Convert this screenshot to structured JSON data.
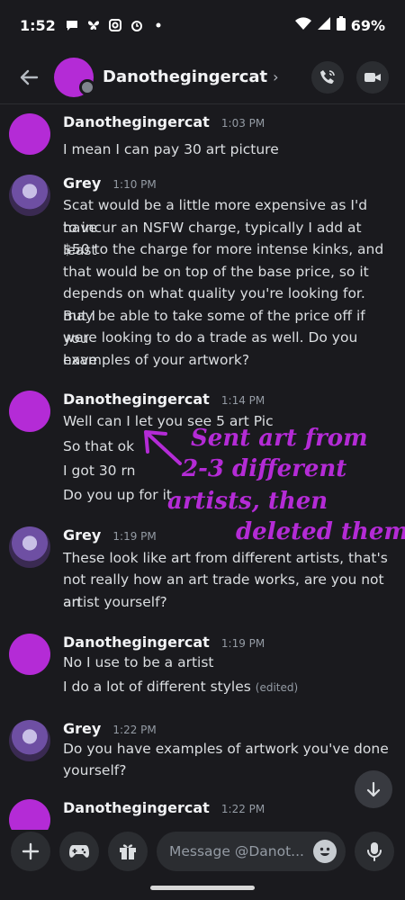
{
  "status_bar": {
    "time": "1:52",
    "battery": "69%"
  },
  "header": {
    "name": "Danothegingercat",
    "chevron": "›"
  },
  "messages": [
    {
      "author": "Danothegingercat",
      "time": "1:03 PM",
      "avatar": "pink",
      "lines": [
        "I mean I can pay 30 art picture"
      ]
    },
    {
      "author": "Grey",
      "time": "1:10 PM",
      "avatar": "grey",
      "lines": [
        "Scat would be a little more expensive as I'd have",
        "to incur an NSFW charge, typically I add at least",
        "$50 to the charge for more intense kinks, and",
        "that would be on top of the base price, so it",
        "depends on what quality you're looking for. But I",
        "may be able to take some of the price off if you",
        "were looking to do a trade as well. Do you have",
        "examples of your artwork?"
      ]
    },
    {
      "author": "Danothegingercat",
      "time": "1:14 PM",
      "avatar": "pink",
      "lines": [
        "Well can I let you see 5 art Pic",
        "So that ok",
        "I got 30 rn",
        "Do you up for it"
      ]
    },
    {
      "author": "Grey",
      "time": "1:19 PM",
      "avatar": "grey",
      "lines": [
        "These look like art from different artists, that's",
        "not really how an art trade works, are you not an",
        "artist yourself?"
      ]
    },
    {
      "author": "Danothegingercat",
      "time": "1:19 PM",
      "avatar": "pink",
      "lines": [
        "No I use to be a artist",
        "I do a lot of different styles"
      ],
      "edited": "(edited)"
    },
    {
      "author": "Grey",
      "time": "1:22 PM",
      "avatar": "grey",
      "lines": [
        "Do you have examples of artwork you've done",
        "yourself?"
      ]
    },
    {
      "author": "Danothegingercat",
      "time": "1:22 PM",
      "avatar": "pink",
      "lines": []
    }
  ],
  "annotation": {
    "lines": [
      "Sent art from",
      "2-3 different",
      "artists, then",
      "deleted them"
    ],
    "color": "#b42bd6"
  },
  "input": {
    "placeholder": "Message @Danot..."
  },
  "icons": {
    "back": "arrow-left-icon",
    "call": "phone-call-icon",
    "video": "video-camera-icon",
    "add": "plus-icon",
    "games": "gamepad-icon",
    "gift": "gift-icon",
    "emoji": "emoji-icon",
    "mic": "microphone-icon",
    "scroll": "arrow-down-icon"
  },
  "colors": {
    "background": "#1a1a1e",
    "accent": "#b42bd6"
  }
}
